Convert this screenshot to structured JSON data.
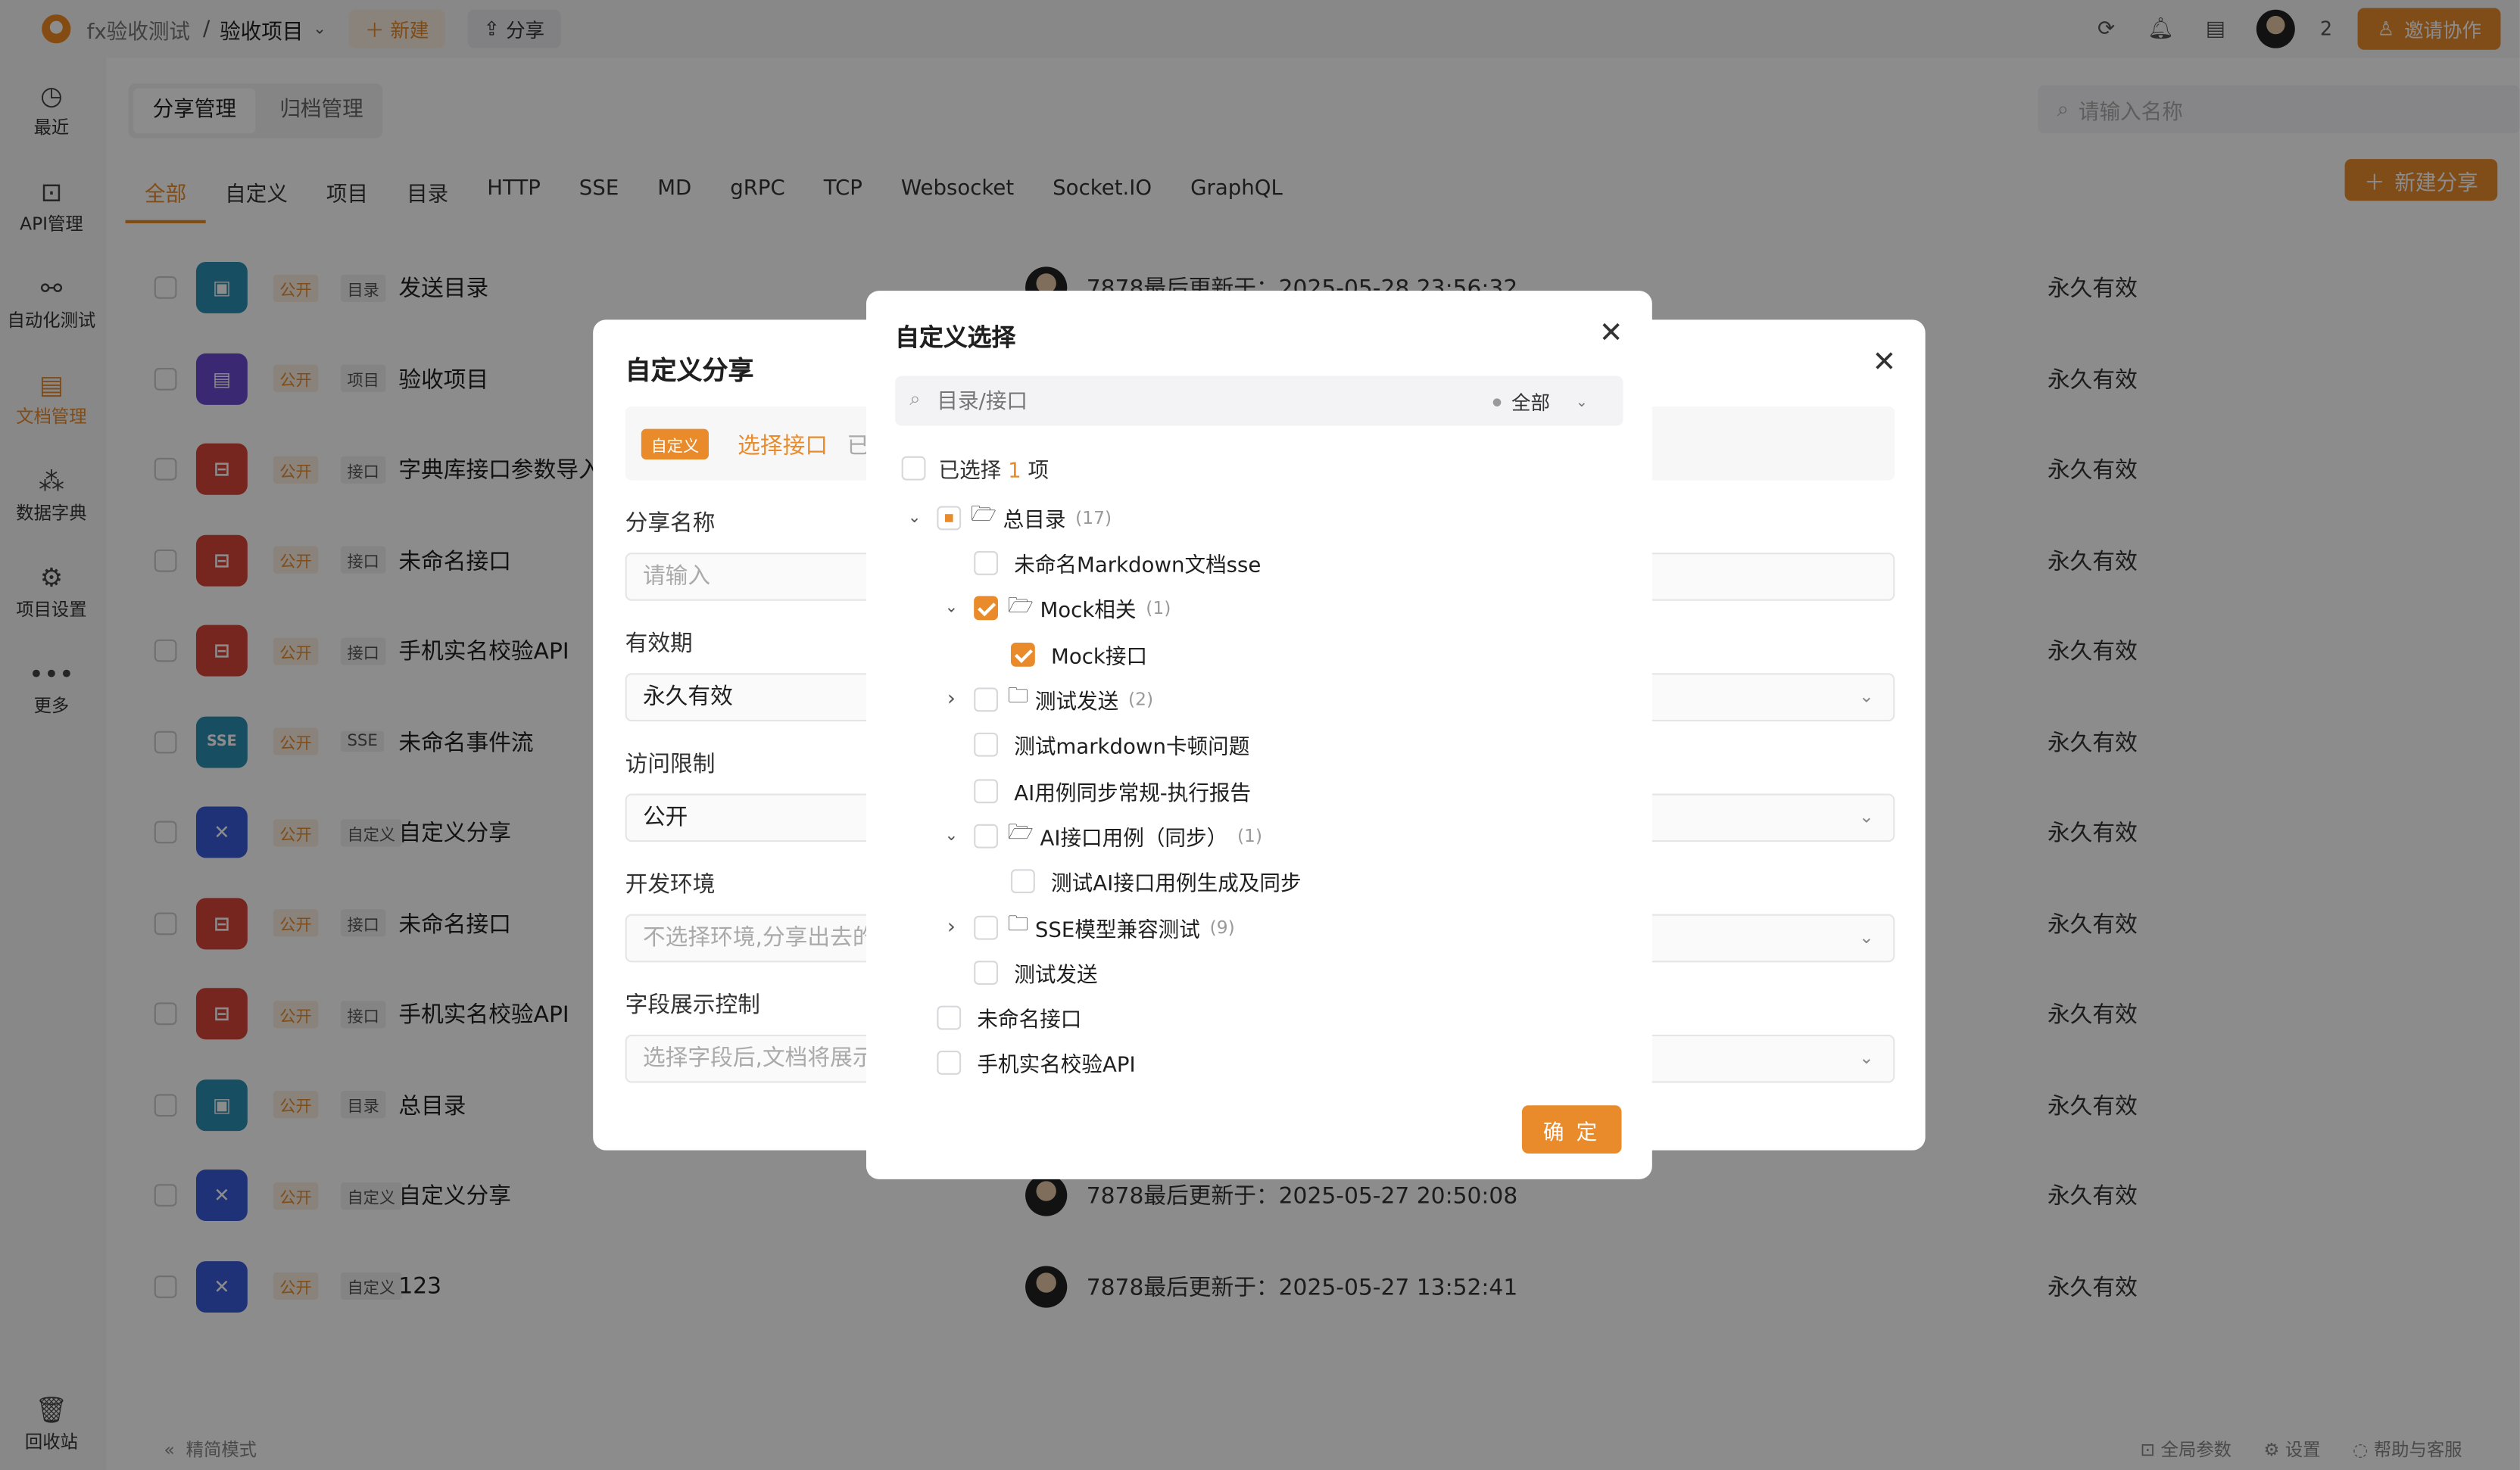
{
  "topbar": {
    "team": "fx验收测试",
    "separator": "/",
    "project": "验收项目",
    "new_label": "新建",
    "share_label": "分享",
    "member_count": "2",
    "invite_label": "邀请协作"
  },
  "sidebar": {
    "items": [
      {
        "icon": "clock-icon",
        "label": "最近"
      },
      {
        "icon": "api-icon",
        "label": "API管理"
      },
      {
        "icon": "flow-icon",
        "label": "自动化测试"
      },
      {
        "icon": "doc-icon",
        "label": "文档管理"
      },
      {
        "icon": "dict-icon",
        "label": "数据字典"
      },
      {
        "icon": "settings-icon",
        "label": "项目设置"
      },
      {
        "icon": "more-icon",
        "label": "更多"
      }
    ],
    "trash_label": "回收站"
  },
  "main": {
    "subtabs": [
      "分享管理",
      "归档管理"
    ],
    "search_placeholder": "请输入名称",
    "filter_tabs": [
      "全部",
      "自定义",
      "项目",
      "目录",
      "HTTP",
      "SSE",
      "MD",
      "gRPC",
      "TCP",
      "Websocket",
      "Socket.IO",
      "GraphQL"
    ],
    "new_share_label": "新建分享",
    "public_label": "公开",
    "rows": [
      {
        "kind": "目录",
        "name": "发送目录",
        "update": "7878最后更新于：2025-05-28 23:56:32",
        "valid": "永久有效",
        "color": "#2a8fb3",
        "glyph": "▣"
      },
      {
        "kind": "项目",
        "name": "验收项目",
        "update": "",
        "valid": "永久有效",
        "color": "#6a4ccf",
        "glyph": "▤"
      },
      {
        "kind": "接口",
        "name": "字典库接口参数导入",
        "update": "",
        "valid": "永久有效",
        "color": "#d8443a",
        "glyph": "⊟"
      },
      {
        "kind": "接口",
        "name": "未命名接口",
        "update": "",
        "valid": "永久有效",
        "color": "#d8443a",
        "glyph": "⊟"
      },
      {
        "kind": "接口",
        "name": "手机实名校验API",
        "update": "",
        "valid": "永久有效",
        "color": "#d8443a",
        "glyph": "⊟"
      },
      {
        "kind": "SSE",
        "name": "未命名事件流",
        "update": "",
        "valid": "永久有效",
        "color": "#2a8fb3",
        "glyph": "SSE"
      },
      {
        "kind": "自定义",
        "name": "自定义分享",
        "update": "",
        "valid": "永久有效",
        "color": "#3a5bd9",
        "glyph": "✕"
      },
      {
        "kind": "接口",
        "name": "未命名接口",
        "update": "",
        "valid": "永久有效",
        "color": "#d8443a",
        "glyph": "⊟"
      },
      {
        "kind": "接口",
        "name": "手机实名校验API",
        "update": "",
        "valid": "永久有效",
        "color": "#d8443a",
        "glyph": "⊟"
      },
      {
        "kind": "目录",
        "name": "总目录",
        "update": "",
        "valid": "永久有效",
        "color": "#2a8fb3",
        "glyph": "▣"
      },
      {
        "kind": "自定义",
        "name": "自定义分享",
        "update": "7878最后更新于：2025-05-27 20:50:08",
        "valid": "永久有效",
        "color": "#3a5bd9",
        "glyph": "✕"
      },
      {
        "kind": "自定义",
        "name": "123",
        "update": "7878最后更新于：2025-05-27 13:52:41",
        "valid": "永久有效",
        "color": "#3a5bd9",
        "glyph": "✕"
      }
    ],
    "bottom_left": "精简模式",
    "bottom_right": [
      "全局参数",
      "设置",
      "帮助与客服"
    ]
  },
  "share_dialog": {
    "title": "自定义分享",
    "tag": "自定义",
    "step_active": "选择接口",
    "step_next": "已",
    "labels": {
      "name": "分享名称",
      "validity": "有效期",
      "access": "访问限制",
      "env": "开发环境",
      "fields": "字段展示控制"
    },
    "name_placeholder": "请输入",
    "validity_value": "永久有效",
    "access_value": "公开",
    "env_placeholder": "不选择环境,分享出去的文",
    "fields_placeholder": "选择字段后,文档将展示字"
  },
  "select_dialog": {
    "title": "自定义选择",
    "search_placeholder": "目录/接口",
    "filter_label": "全部",
    "selected_prefix": "已选择",
    "selected_count": "1",
    "selected_suffix": "项",
    "confirm_label": "确 定",
    "tree": [
      {
        "level": 0,
        "toggle": "open",
        "check": "partial",
        "folder": "open",
        "label": "总目录",
        "count": "(17)"
      },
      {
        "level": 1,
        "toggle": "none",
        "check": "off",
        "folder": "none",
        "label": "未命名Markdown文档sse",
        "count": ""
      },
      {
        "level": 1,
        "toggle": "open",
        "check": "on",
        "folder": "open",
        "label": "Mock相关",
        "count": "(1)"
      },
      {
        "level": 2,
        "toggle": "none",
        "check": "on",
        "folder": "none",
        "label": "Mock接口",
        "count": ""
      },
      {
        "level": 1,
        "toggle": "closed",
        "check": "off",
        "folder": "closed",
        "label": "测试发送",
        "count": "(2)"
      },
      {
        "level": 1,
        "toggle": "none",
        "check": "off",
        "folder": "none",
        "label": "测试markdown卡顿问题",
        "count": ""
      },
      {
        "level": 1,
        "toggle": "none",
        "check": "off",
        "folder": "none",
        "label": "AI用例同步常规-执行报告",
        "count": ""
      },
      {
        "level": 1,
        "toggle": "open",
        "check": "off",
        "folder": "open",
        "label": "AI接口用例（同步）",
        "count": "(1)"
      },
      {
        "level": 2,
        "toggle": "none",
        "check": "off",
        "folder": "none",
        "label": "测试AI接口用例生成及同步",
        "count": ""
      },
      {
        "level": 1,
        "toggle": "closed",
        "check": "off",
        "folder": "closed",
        "label": "SSE模型兼容测试",
        "count": "(9)"
      },
      {
        "level": 1,
        "toggle": "none",
        "check": "off",
        "folder": "none",
        "label": "测试发送",
        "count": ""
      },
      {
        "level": 0,
        "toggle": "none",
        "check": "off",
        "folder": "none",
        "label": "未命名接口",
        "count": ""
      },
      {
        "level": 0,
        "toggle": "none",
        "check": "off",
        "folder": "none",
        "label": "手机实名校验API",
        "count": ""
      }
    ]
  },
  "colors": {
    "accent": "#e98b2a"
  }
}
